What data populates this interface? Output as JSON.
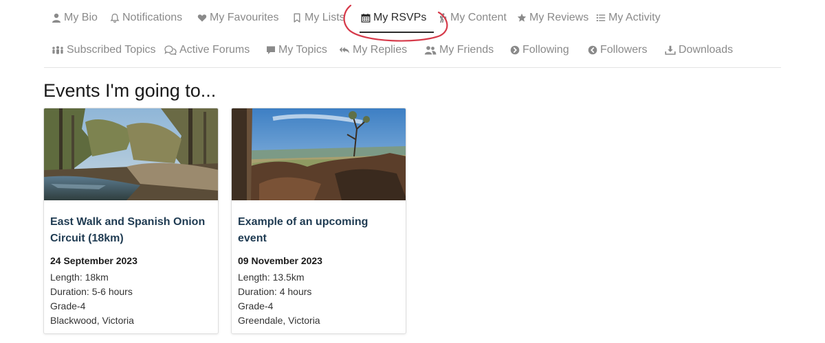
{
  "nav": {
    "row1": [
      {
        "label": "My Bio",
        "icon": "user-icon",
        "active": false
      },
      {
        "label": "Notifications",
        "icon": "bell-icon",
        "active": false
      },
      {
        "label": "My Favourites",
        "icon": "heart-icon",
        "active": false
      },
      {
        "label": "My Lists",
        "icon": "bookmark-icon",
        "active": false
      },
      {
        "label": "My RSVPs",
        "icon": "calendar-icon",
        "active": true
      },
      {
        "label": "My Content",
        "icon": "hiker-icon",
        "active": false
      },
      {
        "label": "My Reviews",
        "icon": "star-icon",
        "active": false
      },
      {
        "label": "My Activity",
        "icon": "list-icon",
        "active": false
      }
    ],
    "row2": [
      {
        "label": "Subscribed Topics",
        "icon": "people-group-icon"
      },
      {
        "label": "Active Forums",
        "icon": "chat-bubbles-icon"
      },
      {
        "label": "My Topics",
        "icon": "comment-icon"
      },
      {
        "label": "My Replies",
        "icon": "reply-all-icon"
      },
      {
        "label": "My Friends",
        "icon": "users-icon"
      },
      {
        "label": "Following",
        "icon": "circle-chevron-right-icon"
      },
      {
        "label": "Followers",
        "icon": "circle-chevron-left-icon"
      },
      {
        "label": "Downloads",
        "icon": "download-icon"
      }
    ]
  },
  "section_title": "Events I'm going to...",
  "events": [
    {
      "image": "creek-forest-photo",
      "title": "East Walk and Spanish Onion Circuit (18km)",
      "date": "24 September 2023",
      "length": "Length: 18km",
      "duration": "Duration: 5-6 hours",
      "grade": "Grade-4",
      "location": "Blackwood, Victoria"
    },
    {
      "image": "rocky-lookout-photo",
      "title": "Example of an upcoming event",
      "date": "09 November 2023",
      "length": "Length: 13.5km",
      "duration": "Duration: 4 hours",
      "grade": "Grade-4",
      "location": "Greendale, Victoria"
    }
  ],
  "colors": {
    "nav_text": "#8a8a8a",
    "nav_active": "#2b2b2b",
    "card_title": "#1f3b52",
    "annotation": "#d63a4a"
  }
}
